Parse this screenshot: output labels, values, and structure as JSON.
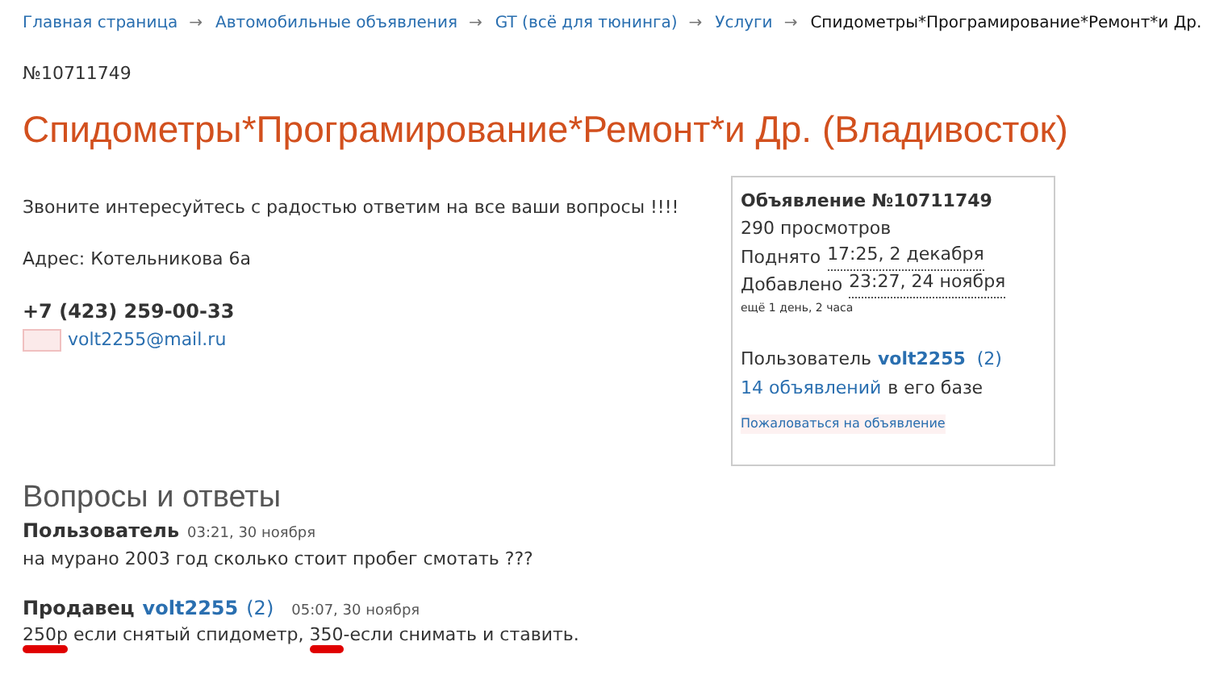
{
  "breadcrumbs": [
    {
      "label": "Главная страница",
      "link": true
    },
    {
      "label": "Автомобильные объявления",
      "link": true
    },
    {
      "label": "GT (всё для тюнинга)",
      "link": true
    },
    {
      "label": "Услуги",
      "link": true
    },
    {
      "label": "Спидометры*Програмирование*Ремонт*и Др.",
      "link": false
    }
  ],
  "separator": "→",
  "ad_number": "№10711749",
  "title": "Спидометры*Програмирование*Ремонт*и Др. (Владивосток)",
  "description": "Звоните интересуйтесь с радостью ответим на все ваши вопросы !!!!",
  "address": "Адрес: Котельникова 6а",
  "phone": "+7 (423) 259-00-33",
  "email": "volt2255@mail.ru",
  "info": {
    "heading": "Объявление №10711749",
    "views": "290 просмотров",
    "raised_label": "Поднято",
    "raised_time": "17:25, 2 декабря",
    "added_label": "Добавлено",
    "added_time": "23:27, 24 ноября",
    "remaining": "ещё 1 день, 2 часа",
    "user_label": "Пользователь",
    "user": "volt2255",
    "user_rating": "(2)",
    "ads_link": "14 объявлений",
    "ads_suffix": "в его базе",
    "report": "Пожаловаться на объявление"
  },
  "qa": {
    "heading": "Вопросы и ответы",
    "entries": [
      {
        "kind": "question",
        "author": "Пользователь",
        "time": "03:21, 30 ноября",
        "segments": [
          {
            "text": "на мурано 2003 год сколько стоит пробег смотать ???",
            "marked": false
          }
        ]
      },
      {
        "kind": "answer",
        "author": "Продавец",
        "user": "volt2255",
        "user_rating": "(2)",
        "time": "05:07, 30 ноября",
        "segments": [
          {
            "text": "250р",
            "marked": true
          },
          {
            "text": " если снятый спидометр, ",
            "marked": false
          },
          {
            "text": "350",
            "marked": true
          },
          {
            "text": "-если снимать и ставить.",
            "marked": false
          }
        ]
      }
    ]
  }
}
